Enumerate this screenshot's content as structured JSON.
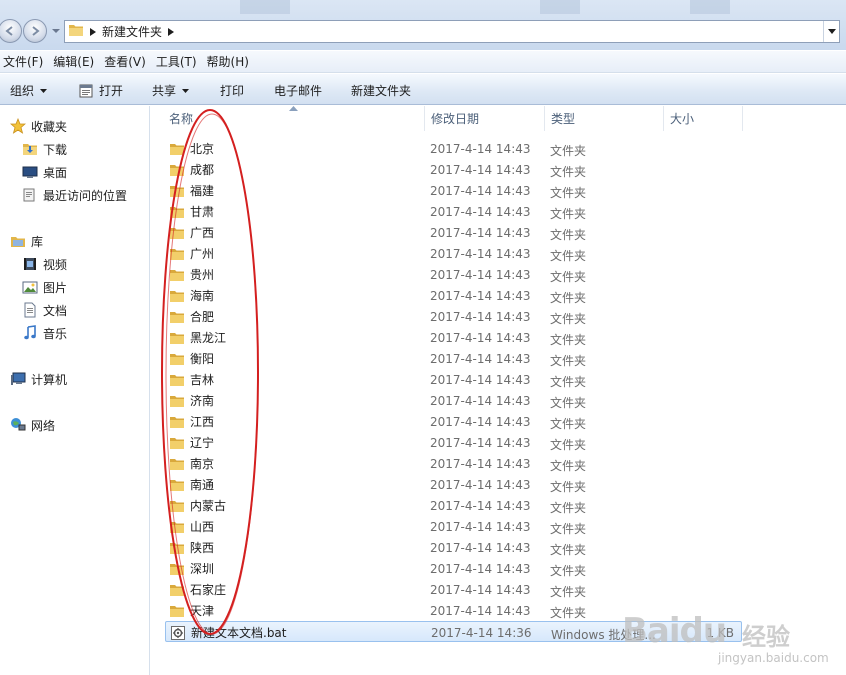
{
  "address_bar": {
    "path": "新建文件夹"
  },
  "menu": [
    "文件(F)",
    "编辑(E)",
    "查看(V)",
    "工具(T)",
    "帮助(H)"
  ],
  "toolbar": {
    "organize": "组织",
    "open": "打开",
    "share": "共享",
    "print": "打印",
    "email": "电子邮件",
    "new_folder": "新建文件夹"
  },
  "nav": {
    "favorites": "收藏夹",
    "downloads": "下载",
    "desktop": "桌面",
    "recent": "最近访问的位置",
    "libraries": "库",
    "videos": "视频",
    "pictures": "图片",
    "documents": "文档",
    "music": "音乐",
    "computer": "计算机",
    "network": "网络"
  },
  "columns": {
    "name": "名称",
    "date": "修改日期",
    "type": "类型",
    "size": "大小"
  },
  "files": [
    {
      "name": "北京",
      "date": "2017-4-14 14:43",
      "type": "文件夹",
      "size": "",
      "kind": "folder"
    },
    {
      "name": "成都",
      "date": "2017-4-14 14:43",
      "type": "文件夹",
      "size": "",
      "kind": "folder"
    },
    {
      "name": "福建",
      "date": "2017-4-14 14:43",
      "type": "文件夹",
      "size": "",
      "kind": "folder"
    },
    {
      "name": "甘肃",
      "date": "2017-4-14 14:43",
      "type": "文件夹",
      "size": "",
      "kind": "folder"
    },
    {
      "name": "广西",
      "date": "2017-4-14 14:43",
      "type": "文件夹",
      "size": "",
      "kind": "folder"
    },
    {
      "name": "广州",
      "date": "2017-4-14 14:43",
      "type": "文件夹",
      "size": "",
      "kind": "folder"
    },
    {
      "name": "贵州",
      "date": "2017-4-14 14:43",
      "type": "文件夹",
      "size": "",
      "kind": "folder"
    },
    {
      "name": "海南",
      "date": "2017-4-14 14:43",
      "type": "文件夹",
      "size": "",
      "kind": "folder"
    },
    {
      "name": "合肥",
      "date": "2017-4-14 14:43",
      "type": "文件夹",
      "size": "",
      "kind": "folder"
    },
    {
      "name": "黑龙江",
      "date": "2017-4-14 14:43",
      "type": "文件夹",
      "size": "",
      "kind": "folder"
    },
    {
      "name": "衡阳",
      "date": "2017-4-14 14:43",
      "type": "文件夹",
      "size": "",
      "kind": "folder"
    },
    {
      "name": "吉林",
      "date": "2017-4-14 14:43",
      "type": "文件夹",
      "size": "",
      "kind": "folder"
    },
    {
      "name": "济南",
      "date": "2017-4-14 14:43",
      "type": "文件夹",
      "size": "",
      "kind": "folder"
    },
    {
      "name": "江西",
      "date": "2017-4-14 14:43",
      "type": "文件夹",
      "size": "",
      "kind": "folder"
    },
    {
      "name": "辽宁",
      "date": "2017-4-14 14:43",
      "type": "文件夹",
      "size": "",
      "kind": "folder"
    },
    {
      "name": "南京",
      "date": "2017-4-14 14:43",
      "type": "文件夹",
      "size": "",
      "kind": "folder"
    },
    {
      "name": "南通",
      "date": "2017-4-14 14:43",
      "type": "文件夹",
      "size": "",
      "kind": "folder"
    },
    {
      "name": "内蒙古",
      "date": "2017-4-14 14:43",
      "type": "文件夹",
      "size": "",
      "kind": "folder"
    },
    {
      "name": "山西",
      "date": "2017-4-14 14:43",
      "type": "文件夹",
      "size": "",
      "kind": "folder"
    },
    {
      "name": "陕西",
      "date": "2017-4-14 14:43",
      "type": "文件夹",
      "size": "",
      "kind": "folder"
    },
    {
      "name": "深圳",
      "date": "2017-4-14 14:43",
      "type": "文件夹",
      "size": "",
      "kind": "folder"
    },
    {
      "name": "石家庄",
      "date": "2017-4-14 14:43",
      "type": "文件夹",
      "size": "",
      "kind": "folder"
    },
    {
      "name": "天津",
      "date": "2017-4-14 14:43",
      "type": "文件夹",
      "size": "",
      "kind": "folder"
    },
    {
      "name": "新建文本文档.bat",
      "date": "2017-4-14 14:36",
      "type": "Windows 批处理...",
      "size": "1 KB",
      "kind": "bat",
      "selected": true
    }
  ],
  "watermark": {
    "logo": "Baidu",
    "logo_cn": "经验",
    "url": "jingyan.baidu.com"
  },
  "colors": {
    "annotation": "#d42020",
    "folder": "#e8c15a",
    "selection": "#d7e8fb"
  }
}
